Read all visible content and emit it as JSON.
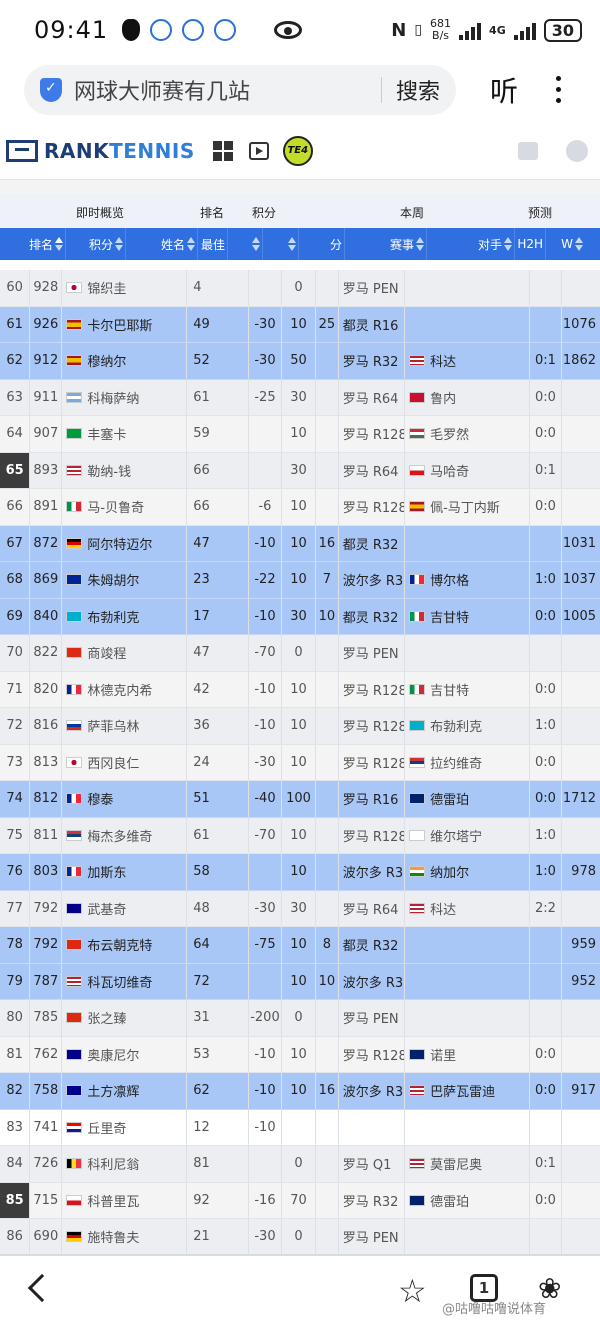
{
  "status": {
    "time": "09:41",
    "speed": "681",
    "speed_unit": "B/s",
    "net": "4G",
    "battery": "30"
  },
  "search": {
    "query": "网球大师赛有几站",
    "button": "搜索",
    "listen": "听"
  },
  "site": {
    "logo_a": "RANK",
    "logo_b": "TENNIS",
    "te_badge": "TE4"
  },
  "group_headers": {
    "live": "即时概览",
    "rank": "排名",
    "points": "积分",
    "week": "本周",
    "forecast": "预测"
  },
  "columns": {
    "rank": "排名",
    "points": "积分",
    "name": "姓名",
    "best": "最佳",
    "points2": "分",
    "event": "赛事",
    "opponent": "对手",
    "h2h": "H2H",
    "win": "W"
  },
  "colors": {
    "accent": "#2f6fe0",
    "highlight": "#a8c7f6",
    "rank_dark": "#3c3c3c"
  },
  "rows": [
    {
      "rank": "60",
      "pts": "928",
      "flag": "JPN",
      "name": "锦织圭",
      "best": "4",
      "chg": "",
      "dp": "0",
      "w": "",
      "tour": "罗马 PEN",
      "opp_flag": "",
      "opp": "",
      "h2h": "",
      "pred": "",
      "style": "alt"
    },
    {
      "rank": "61",
      "pts": "926",
      "flag": "ESP",
      "name": "卡尔巴耶斯",
      "best": "49",
      "chg": "-30",
      "dp": "10",
      "w": "25",
      "tour": "都灵 R16",
      "opp_flag": "",
      "opp": "",
      "h2h": "",
      "pred": "1076",
      "style": "hl"
    },
    {
      "rank": "62",
      "pts": "912",
      "flag": "ESP",
      "name": "穆纳尔",
      "best": "52",
      "chg": "-30",
      "dp": "50",
      "w": "",
      "tour": "罗马 R32",
      "opp_flag": "USA",
      "opp": "科达",
      "h2h": "0:1",
      "pred": "1862",
      "style": "hl"
    },
    {
      "rank": "63",
      "pts": "911",
      "flag": "ARG",
      "name": "科梅萨纳",
      "best": "61",
      "chg": "-25",
      "dp": "30",
      "w": "",
      "tour": "罗马 R64",
      "opp_flag": "DEN",
      "opp": "鲁内",
      "h2h": "0:0",
      "pred": "",
      "style": "alt"
    },
    {
      "rank": "64",
      "pts": "907",
      "flag": "BRA",
      "name": "丰塞卡",
      "best": "59",
      "chg": "",
      "dp": "10",
      "w": "",
      "tour": "罗马 R128",
      "opp_flag": "HUN",
      "opp": "毛罗然",
      "h2h": "0:0",
      "pred": "",
      "style": "norm"
    },
    {
      "rank": "65",
      "pts": "893",
      "flag": "USA",
      "name": "勒纳-钱",
      "best": "66",
      "chg": "",
      "dp": "30",
      "w": "",
      "tour": "罗马 R64",
      "opp_flag": "CZE",
      "opp": "马哈奇",
      "h2h": "0:1",
      "pred": "",
      "style": "alt",
      "dark": true
    },
    {
      "rank": "66",
      "pts": "891",
      "flag": "ITA",
      "name": "马-贝鲁奇",
      "best": "66",
      "chg": "-6",
      "dp": "10",
      "w": "",
      "tour": "罗马 R128",
      "opp_flag": "ESP",
      "opp": "佩-马丁内斯",
      "h2h": "0:0",
      "pred": "",
      "style": "norm"
    },
    {
      "rank": "67",
      "pts": "872",
      "flag": "GER",
      "name": "阿尔特迈尔",
      "best": "47",
      "chg": "-10",
      "dp": "10",
      "w": "16",
      "tour": "都灵 R32",
      "opp_flag": "",
      "opp": "",
      "h2h": "",
      "pred": "1031",
      "style": "hl"
    },
    {
      "rank": "68",
      "pts": "869",
      "flag": "BIH",
      "name": "朱姆胡尔",
      "best": "23",
      "chg": "-22",
      "dp": "10",
      "w": "7",
      "tour": "波尔多 R32",
      "opp_flag": "FRA",
      "opp": "博尔格",
      "h2h": "1:0",
      "pred": "1037",
      "style": "hl"
    },
    {
      "rank": "69",
      "pts": "840",
      "flag": "KAZ",
      "name": "布勃利克",
      "best": "17",
      "chg": "-10",
      "dp": "30",
      "w": "10",
      "tour": "都灵 R32",
      "opp_flag": "ITA",
      "opp": "吉甘特",
      "h2h": "0:0",
      "pred": "1005",
      "style": "hl"
    },
    {
      "rank": "70",
      "pts": "822",
      "flag": "CHN",
      "name": "商竣程",
      "best": "47",
      "chg": "-70",
      "dp": "0",
      "w": "",
      "tour": "罗马 PEN",
      "opp_flag": "",
      "opp": "",
      "h2h": "",
      "pred": "",
      "style": "alt"
    },
    {
      "rank": "71",
      "pts": "820",
      "flag": "FRA",
      "name": "林德克内希",
      "best": "42",
      "chg": "-10",
      "dp": "10",
      "w": "",
      "tour": "罗马 R128",
      "opp_flag": "ITA",
      "opp": "吉甘特",
      "h2h": "0:0",
      "pred": "",
      "style": "norm"
    },
    {
      "rank": "72",
      "pts": "816",
      "flag": "RUS",
      "name": "萨菲乌林",
      "best": "36",
      "chg": "-10",
      "dp": "10",
      "w": "",
      "tour": "罗马 R128",
      "opp_flag": "KAZ",
      "opp": "布勃利克",
      "h2h": "1:0",
      "pred": "",
      "style": "alt"
    },
    {
      "rank": "73",
      "pts": "813",
      "flag": "JPN",
      "name": "西冈良仁",
      "best": "24",
      "chg": "-30",
      "dp": "10",
      "w": "",
      "tour": "罗马 R128",
      "opp_flag": "SRB",
      "opp": "拉约维奇",
      "h2h": "0:0",
      "pred": "",
      "style": "norm"
    },
    {
      "rank": "74",
      "pts": "812",
      "flag": "FRA",
      "name": "穆泰",
      "best": "51",
      "chg": "-40",
      "dp": "100",
      "w": "",
      "tour": "罗马 R16",
      "opp_flag": "GBR",
      "opp": "德雷珀",
      "h2h": "0:0",
      "pred": "1712",
      "style": "hl"
    },
    {
      "rank": "75",
      "pts": "811",
      "flag": "SRB",
      "name": "梅杰多维奇",
      "best": "61",
      "chg": "-70",
      "dp": "10",
      "w": "",
      "tour": "罗马 R128",
      "opp_flag": "FIN",
      "opp": "维尔塔宁",
      "h2h": "1:0",
      "pred": "",
      "style": "alt"
    },
    {
      "rank": "76",
      "pts": "803",
      "flag": "FRA",
      "name": "加斯东",
      "best": "58",
      "chg": "",
      "dp": "10",
      "w": "",
      "tour": "波尔多 R32",
      "opp_flag": "IND",
      "opp": "纳加尔",
      "h2h": "1:0",
      "pred": "978",
      "style": "hl"
    },
    {
      "rank": "77",
      "pts": "792",
      "flag": "AUS",
      "name": "武基奇",
      "best": "48",
      "chg": "-30",
      "dp": "30",
      "w": "",
      "tour": "罗马 R64",
      "opp_flag": "USA",
      "opp": "科达",
      "h2h": "2:2",
      "pred": "",
      "style": "alt"
    },
    {
      "rank": "78",
      "pts": "792",
      "flag": "CHN",
      "name": "布云朝克特",
      "best": "64",
      "chg": "-75",
      "dp": "10",
      "w": "8",
      "tour": "都灵 R32",
      "opp_flag": "",
      "opp": "",
      "h2h": "",
      "pred": "959",
      "style": "hl"
    },
    {
      "rank": "79",
      "pts": "787",
      "flag": "USA",
      "name": "科瓦切维奇",
      "best": "72",
      "chg": "",
      "dp": "10",
      "w": "10",
      "tour": "波尔多 R32",
      "opp_flag": "",
      "opp": "",
      "h2h": "",
      "pred": "952",
      "style": "hl"
    },
    {
      "rank": "80",
      "pts": "785",
      "flag": "CHN",
      "name": "张之臻",
      "best": "31",
      "chg": "-200",
      "dp": "0",
      "w": "",
      "tour": "罗马 PEN",
      "opp_flag": "",
      "opp": "",
      "h2h": "",
      "pred": "",
      "style": "alt"
    },
    {
      "rank": "81",
      "pts": "762",
      "flag": "AUS",
      "name": "奥康尼尔",
      "best": "53",
      "chg": "-10",
      "dp": "10",
      "w": "",
      "tour": "罗马 R128",
      "opp_flag": "GBR",
      "opp": "诺里",
      "h2h": "0:0",
      "pred": "",
      "style": "norm"
    },
    {
      "rank": "82",
      "pts": "758",
      "flag": "AUS",
      "name": "土方凛辉",
      "best": "62",
      "chg": "-10",
      "dp": "10",
      "w": "16",
      "tour": "波尔多 R32",
      "opp_flag": "USA",
      "opp": "巴萨瓦雷迪",
      "h2h": "0:0",
      "pred": "917",
      "style": "hl"
    },
    {
      "rank": "83",
      "pts": "741",
      "flag": "CRO",
      "name": "丘里奇",
      "best": "12",
      "chg": "-10",
      "dp": "",
      "w": "",
      "tour": "",
      "opp_flag": "",
      "opp": "",
      "h2h": "",
      "pred": "",
      "style": "white"
    },
    {
      "rank": "84",
      "pts": "726",
      "flag": "BEL",
      "name": "科利尼翁",
      "best": "81",
      "chg": "",
      "dp": "0",
      "w": "",
      "tour": "罗马 Q1",
      "opp_flag": "USA",
      "opp": "莫雷尼奥",
      "h2h": "0:1",
      "pred": "",
      "style": "alt"
    },
    {
      "rank": "85",
      "pts": "715",
      "flag": "CZE",
      "name": "科普里瓦",
      "best": "92",
      "chg": "-16",
      "dp": "70",
      "w": "",
      "tour": "罗马 R32",
      "opp_flag": "GBR",
      "opp": "德雷珀",
      "h2h": "0:0",
      "pred": "",
      "style": "norm",
      "dark": true
    },
    {
      "rank": "86",
      "pts": "690",
      "flag": "GER",
      "name": "施特鲁夫",
      "best": "21",
      "chg": "-30",
      "dp": "0",
      "w": "",
      "tour": "罗马 PEN",
      "opp_flag": "",
      "opp": "",
      "h2h": "",
      "pred": "",
      "style": "alt"
    }
  ],
  "bottom": {
    "tab_count": "1",
    "watermark": "@咕噜咕噜说体育"
  }
}
